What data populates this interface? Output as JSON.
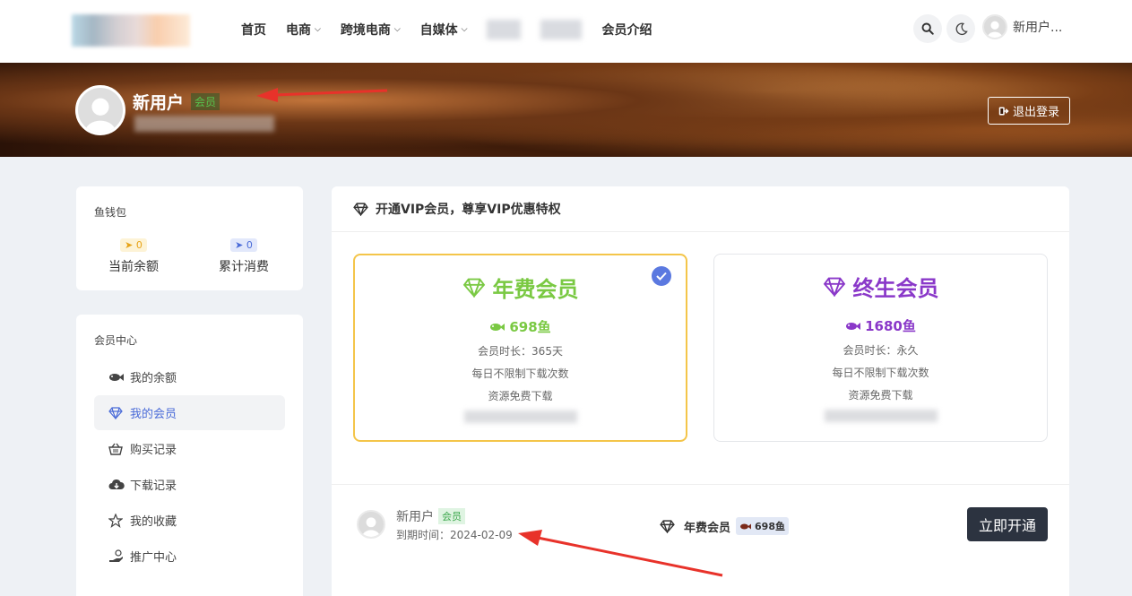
{
  "nav": {
    "items": [
      {
        "label": "首页",
        "dropdown": false
      },
      {
        "label": "电商",
        "dropdown": true
      },
      {
        "label": "跨境电商",
        "dropdown": true
      },
      {
        "label": "自媒体",
        "dropdown": true
      }
    ],
    "last_item": "会员介绍",
    "user_name": "新用户..."
  },
  "banner": {
    "user_name": "新用户",
    "vip_tag": "会员",
    "logout_label": "退出登录"
  },
  "wallet": {
    "title": "鱼钱包",
    "balance_value": "0",
    "balance_label": "当前余额",
    "spent_value": "0",
    "spent_label": "累计消费"
  },
  "vip_center": {
    "title": "会员中心",
    "items": [
      {
        "label": "我的余额",
        "icon": "fish-icon"
      },
      {
        "label": "我的会员",
        "icon": "diamond-icon",
        "active": true
      },
      {
        "label": "购买记录",
        "icon": "basket-icon"
      },
      {
        "label": "下载记录",
        "icon": "cloud-download-icon"
      },
      {
        "label": "我的收藏",
        "icon": "star-icon"
      },
      {
        "label": "推广中心",
        "icon": "hand-coin-icon"
      }
    ]
  },
  "main": {
    "heading": "开通VIP会员，尊享VIP优惠特权",
    "plans": [
      {
        "name": "年费会员",
        "price": "698鱼",
        "duration": "会员时长：365天",
        "benefit1": "每日不限制下载次数",
        "benefit2": "资源免费下载",
        "color": "#7ac943",
        "selected": true
      },
      {
        "name": "终生会员",
        "price": "1680鱼",
        "duration": "会员时长：永久",
        "benefit1": "每日不限制下载次数",
        "benefit2": "资源免费下载",
        "color": "#8a38c9",
        "selected": false
      }
    ],
    "footer": {
      "user_name": "新用户",
      "vip_tag": "会员",
      "expire": "到期时间：2024-02-09",
      "selected_plan": "年费会员",
      "selected_price": "698鱼",
      "buy_label": "立即开通"
    }
  },
  "colors": {
    "accent": "#4a6bd8",
    "annual": "#7ac943",
    "lifetime": "#8a38c9",
    "selected_border": "#f4c54a",
    "annotation_arrow": "#e8322a"
  }
}
